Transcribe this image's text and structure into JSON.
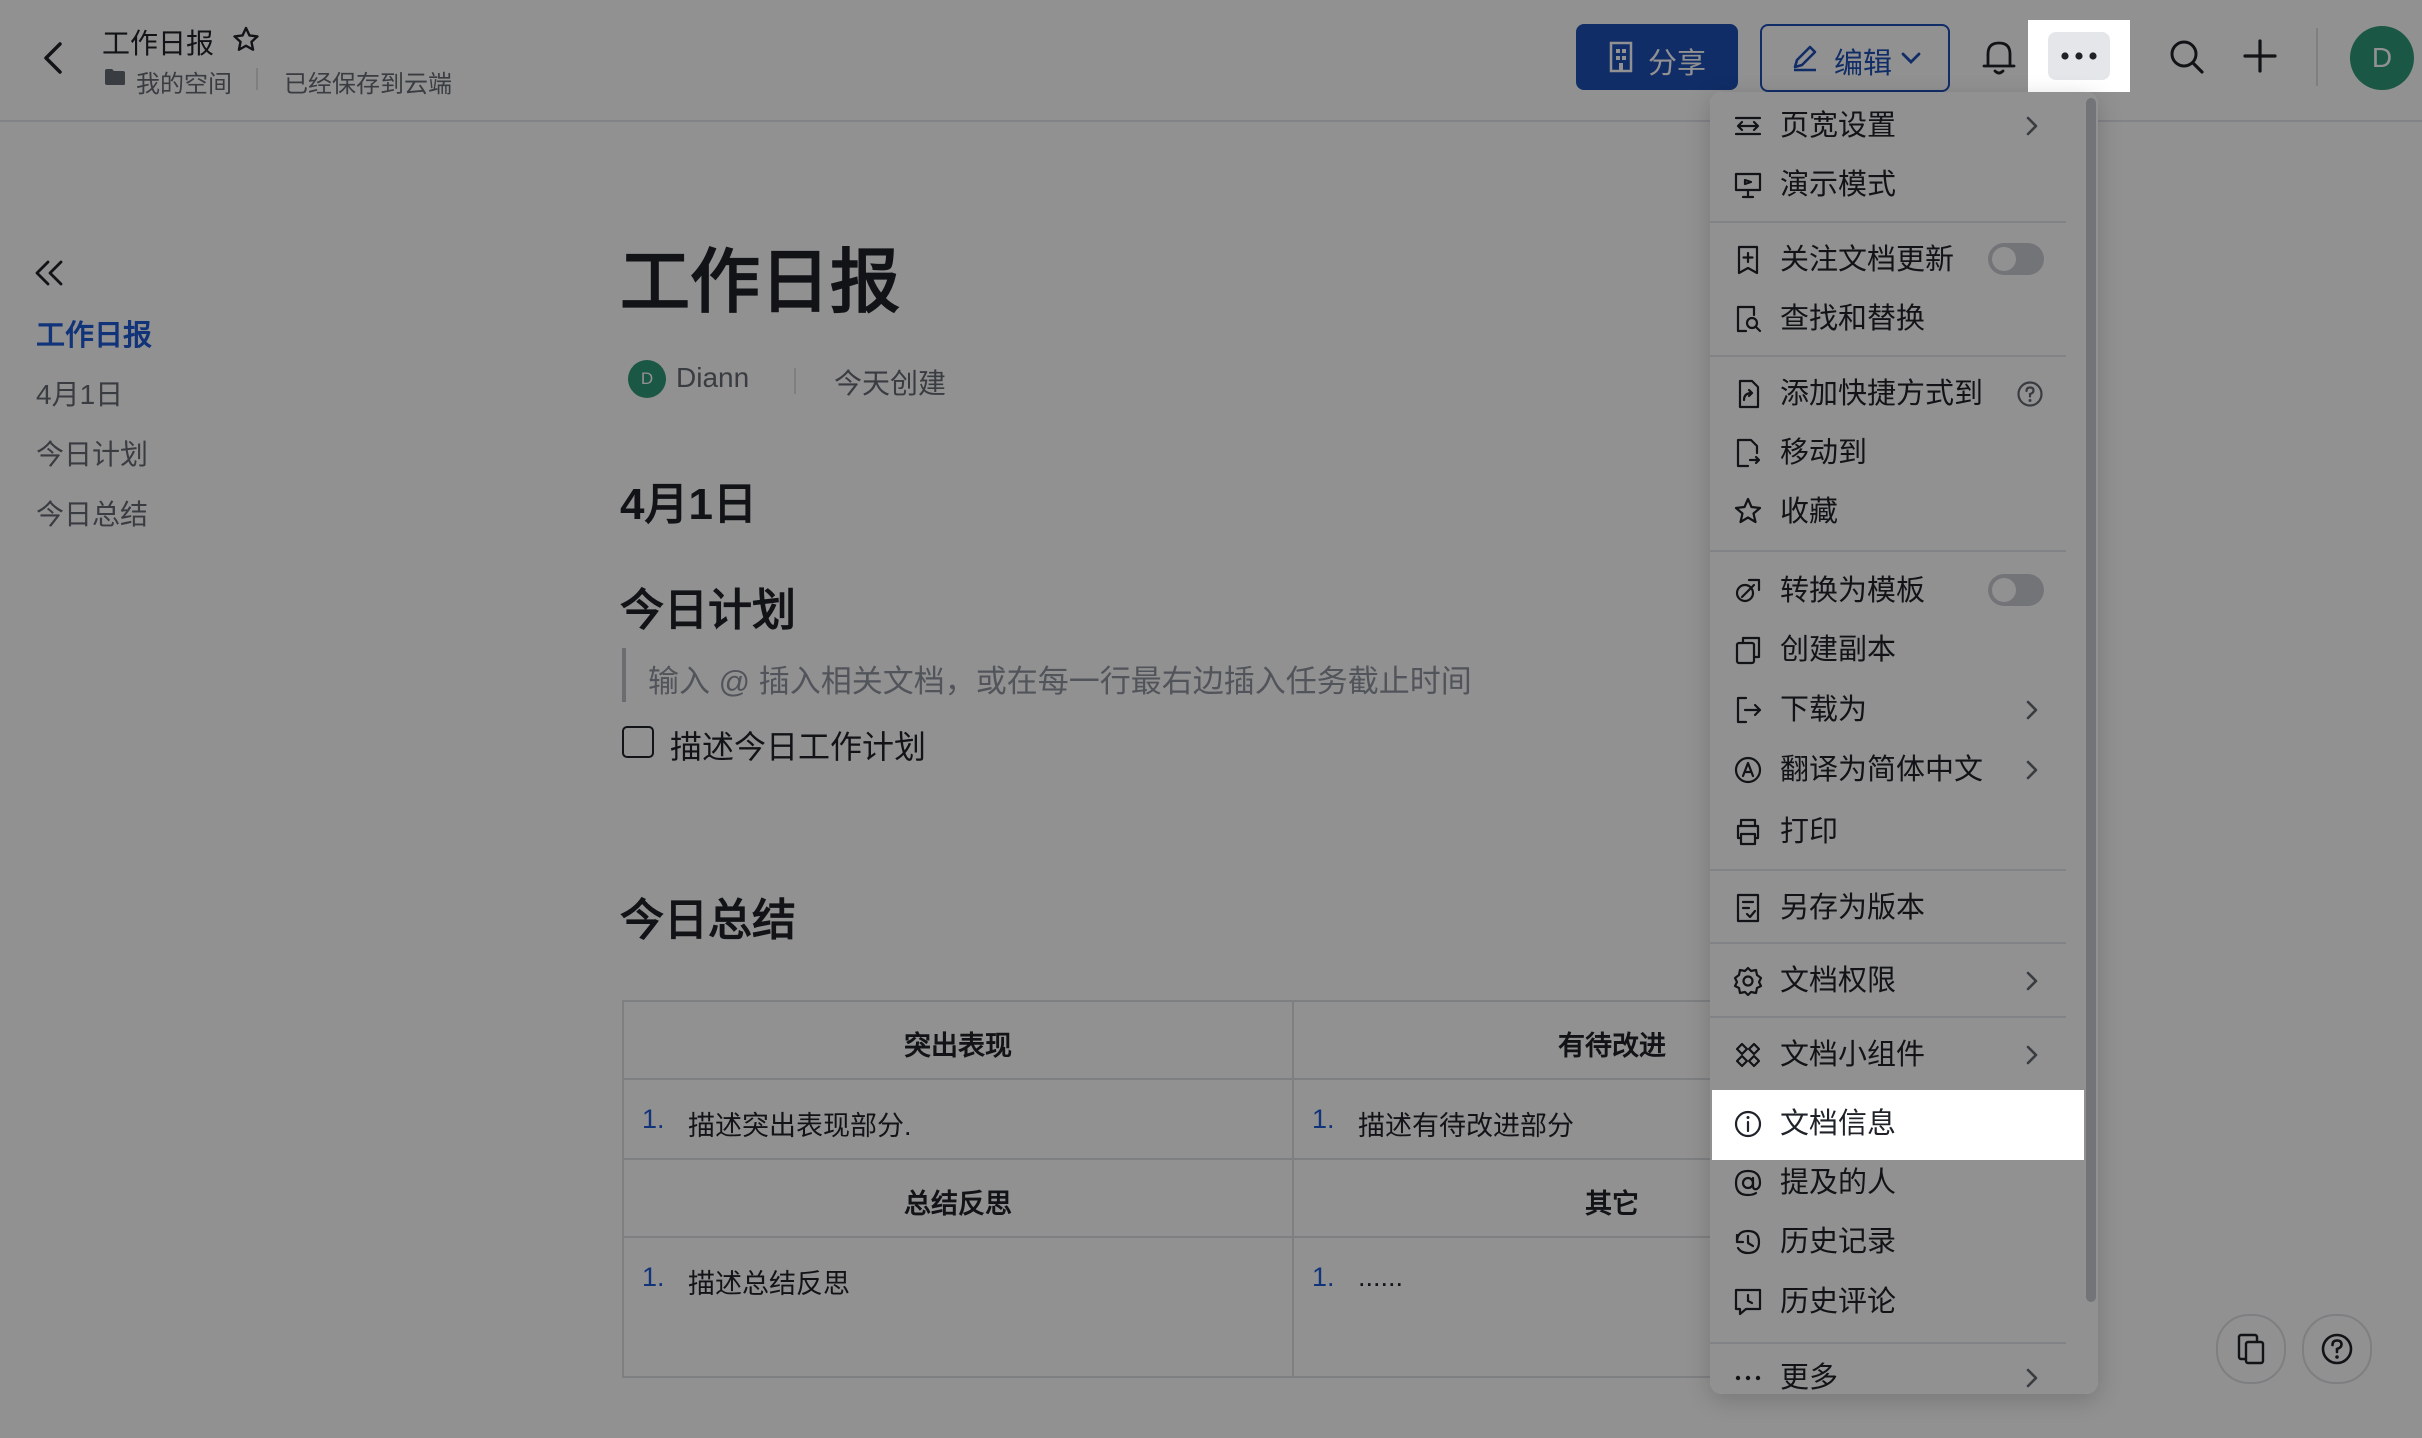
{
  "header": {
    "doc_title": "工作日报",
    "breadcrumb_space": "我的空间",
    "save_status": "已经保存到云端",
    "share_label": "分享",
    "edit_label": "编辑",
    "avatar_letter": "D"
  },
  "outline": {
    "items": [
      "工作日报",
      "4月1日",
      "今日计划",
      "今日总结"
    ]
  },
  "doc": {
    "title": "工作日报",
    "author_avatar": "D",
    "author": "Diann",
    "created": "今天创建",
    "h_date": "4月1日",
    "h_plan": "今日计划",
    "quote_placeholder": "输入 @ 插入相关文档，或在每一行最右边插入任务截止时间",
    "todo_item": "描述今日工作计划",
    "h_summary": "今日总结",
    "table": {
      "headers_row1": [
        "突出表现",
        "有待改进"
      ],
      "row1": [
        {
          "num": "1.",
          "text": "描述突出表现部分."
        },
        {
          "num": "1.",
          "text": "描述有待改进部分"
        }
      ],
      "headers_row2": [
        "总结反思",
        "其它"
      ],
      "row2": [
        {
          "num": "1.",
          "text": "描述总结反思"
        },
        {
          "num": "1.",
          "text": "......"
        }
      ]
    }
  },
  "menu": {
    "items": [
      {
        "label": "页宽设置",
        "icon": "page-width-icon",
        "chevron": true
      },
      {
        "label": "演示模式",
        "icon": "presentation-icon"
      },
      {
        "label": "关注文档更新",
        "icon": "follow-icon",
        "toggle": false
      },
      {
        "label": "查找和替换",
        "icon": "find-replace-icon"
      },
      {
        "label": "添加快捷方式到",
        "icon": "shortcut-icon",
        "help": true
      },
      {
        "label": "移动到",
        "icon": "move-icon"
      },
      {
        "label": "收藏",
        "icon": "star-icon"
      },
      {
        "label": "转换为模板",
        "icon": "template-icon",
        "toggle": false
      },
      {
        "label": "创建副本",
        "icon": "copy-icon"
      },
      {
        "label": "下载为",
        "icon": "download-icon",
        "chevron": true
      },
      {
        "label": "翻译为简体中文",
        "icon": "translate-icon",
        "chevron": true
      },
      {
        "label": "打印",
        "icon": "print-icon"
      },
      {
        "label": "另存为版本",
        "icon": "save-version-icon"
      },
      {
        "label": "文档权限",
        "icon": "settings-icon",
        "chevron": true
      },
      {
        "label": "文档小组件",
        "icon": "widget-icon",
        "chevron": true
      },
      {
        "label": "文档信息",
        "icon": "info-icon"
      },
      {
        "label": "提及的人",
        "icon": "at-icon"
      },
      {
        "label": "历史记录",
        "icon": "history-icon"
      },
      {
        "label": "历史评论",
        "icon": "comment-history-icon"
      },
      {
        "label": "更多",
        "icon": "more-icon",
        "chevron": true
      }
    ]
  },
  "colors": {
    "accent": "#1f5bd6",
    "share_bg": "#1f4fb5",
    "avatar_bg": "#2f9a78",
    "dim": "rgba(0,0,0,0.43)"
  }
}
